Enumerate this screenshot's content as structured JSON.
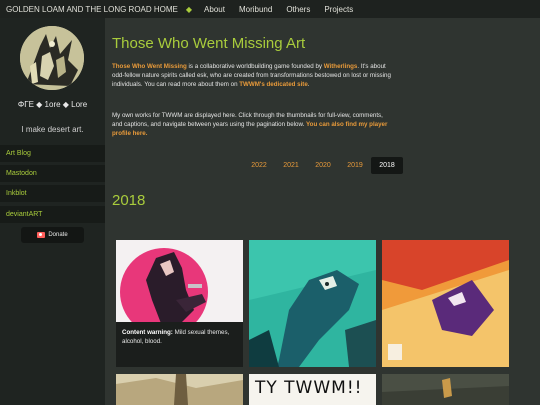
{
  "topnav": {
    "brand": "GOLDEN LOAM AND THE LONG ROAD HOME",
    "diamond": "◆",
    "links": [
      "About",
      "Moribund",
      "Others",
      "Projects"
    ]
  },
  "sidebar": {
    "title": "ΦΓΕ ◆ 1ore ◆ Lore",
    "subtitle": "I make desert art.",
    "links": [
      "Art Blog",
      "Mastodon",
      "Inkblot",
      "deviantART"
    ],
    "donate_label": "Donate"
  },
  "main": {
    "title": "Those Who Went Missing Art",
    "intro": {
      "game_name": "Those Who Went Missing",
      "text1": " is a collaborative worldbuilding game founded by ",
      "founder": "Witherlings",
      "text2": ". It's about odd-fellow nature spirits called esk, who are created from transformations bestowed on lost or missing individuals. You can read more about them on ",
      "site_link": "TWWM's dedicated site",
      "text3": "."
    },
    "intro2": {
      "text": "My own works for TWWM are displayed here. Click through the thumbnails for full-view, comments, and captions, and navigate between years using the pagination below. ",
      "profile_link": "You can also find my player profile here."
    },
    "years": [
      "2022",
      "2021",
      "2020",
      "2019",
      "2018"
    ],
    "active_year": "2018",
    "year_heading": "2018",
    "thumbs": [
      {
        "cw_label": "Content warning:",
        "cw_text": " Mild sexual themes, alcohol, blood."
      }
    ],
    "thumb_text": "TY TWWM!!"
  },
  "colors": {
    "accent_green": "#a9cc3c",
    "accent_orange": "#e89a3a",
    "background": "#2f3430",
    "sidebar": "#1f2421"
  }
}
